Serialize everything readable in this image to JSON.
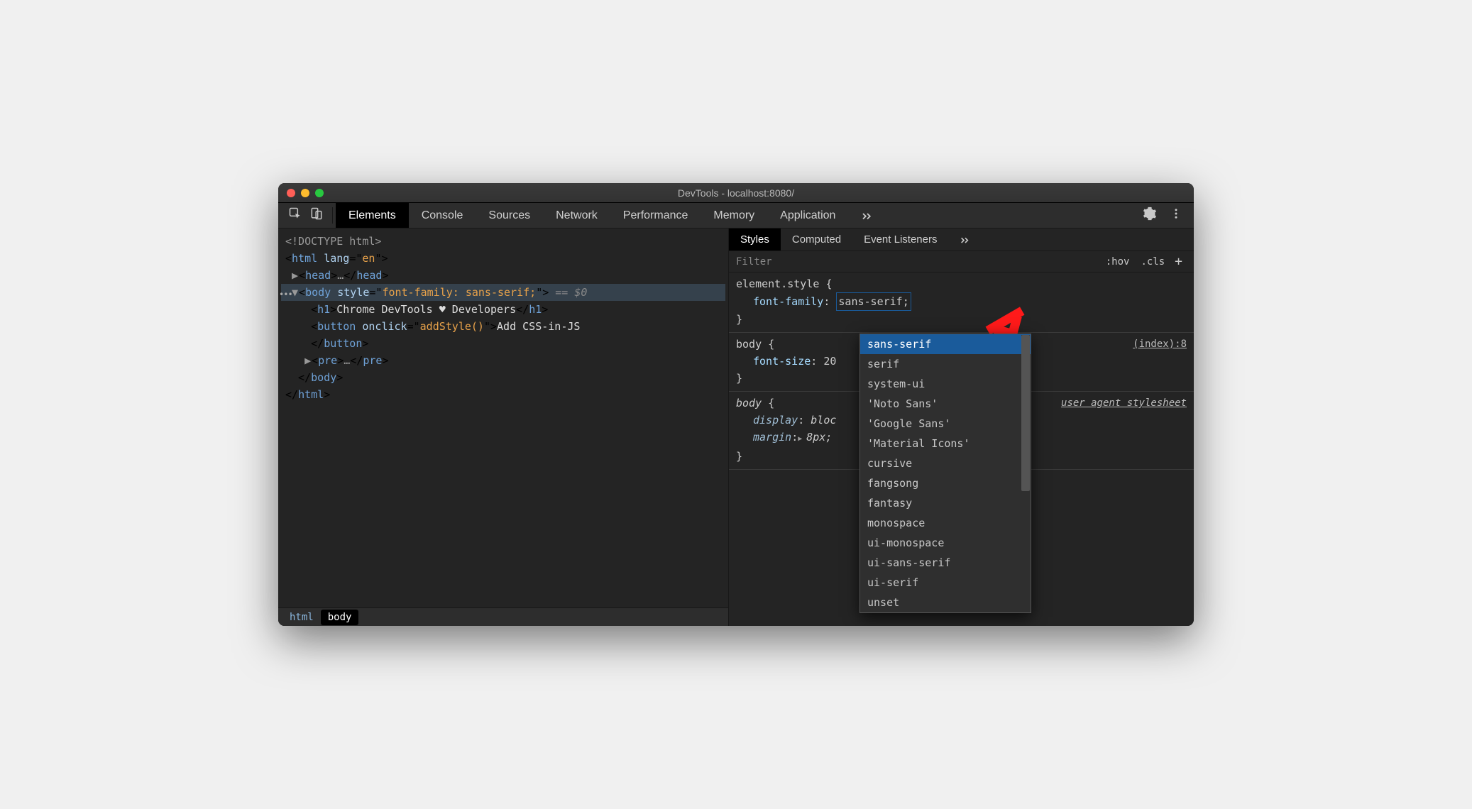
{
  "window_title": "DevTools - localhost:8080/",
  "tabs": [
    "Elements",
    "Console",
    "Sources",
    "Network",
    "Performance",
    "Memory",
    "Application"
  ],
  "active_tab_index": 0,
  "crumbs": [
    "html",
    "body"
  ],
  "active_crumb_index": 1,
  "dom": {
    "doctype": "<!DOCTYPE html>",
    "html_open_tag": "html",
    "html_attr_name": "lang",
    "html_attr_val": "en",
    "head_tag": "head",
    "body_tag": "body",
    "body_attr_name": "style",
    "body_attr_val": "font-family: sans-serif;",
    "body_suffix": "== $0",
    "h1_tag": "h1",
    "h1_text": "Chrome DevTools ♥ Developers",
    "button_tag": "button",
    "button_attr_name": "onclick",
    "button_attr_val": "addStyle()",
    "button_text": "Add CSS-in-JS",
    "pre_tag": "pre",
    "ellipsis": "…"
  },
  "subtabs": [
    "Styles",
    "Computed",
    "Event Listeners"
  ],
  "active_subtab_index": 0,
  "filter_placeholder": "Filter",
  "filter_pills": [
    ":hov",
    ".cls"
  ],
  "styles": {
    "rule1_selector": "element.style",
    "rule1_prop": "font-family",
    "rule1_val": "sans-serif",
    "rule2_selector": "body",
    "rule2_src": "(index):8",
    "rule2_prop": "font-size",
    "rule2_val": "20",
    "rule3_selector": "body",
    "rule3_src": "user agent stylesheet",
    "rule3_p1": "display",
    "rule3_v1": "bloc",
    "rule3_p2": "margin",
    "rule3_v2": "8px;"
  },
  "autocomplete": [
    "sans-serif",
    "serif",
    "system-ui",
    "'Noto Sans'",
    "'Google Sans'",
    "'Material Icons'",
    "cursive",
    "fangsong",
    "fantasy",
    "monospace",
    "ui-monospace",
    "ui-sans-serif",
    "ui-serif",
    "unset"
  ],
  "autocomplete_selected_index": 0
}
